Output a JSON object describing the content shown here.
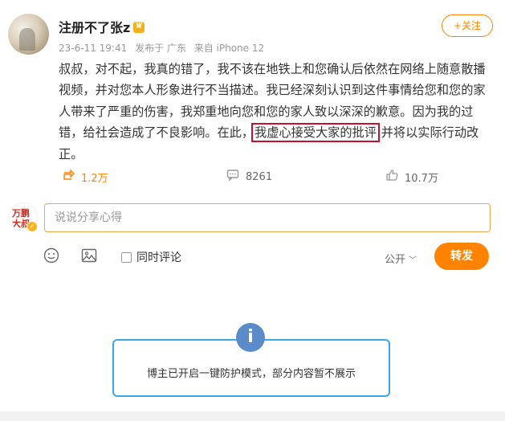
{
  "post": {
    "username": "注册不了张z",
    "date": "23-6-11 19:41",
    "source_location": "发布于 广东",
    "device": "来自 iPhone 12",
    "follow_label": "+关注",
    "text_part1": "叔叔，对不起，我真的错了，我不该在地铁上和您确认后依然在网络上随意散播视频，并对您本人形象进行不当描述。我已经深刻认识到这件事情给您和您的家人带来了严重的伤害，我郑重地向您和您的家人致以深深的歉意。因为我的过错，给社会造成了不良影响。在此，",
    "text_highlight": "我虚心接受大家的批评",
    "text_part2": "  并将以实际行动改正。"
  },
  "actions": {
    "repost_count": "1.2万",
    "comment_count": "8261",
    "like_count": "10.7万"
  },
  "composer": {
    "avatar_line1": "万鹏",
    "avatar_line2": "大叔",
    "placeholder": "说说分享心得",
    "same_time_comment": "同时评论",
    "visibility": "公开",
    "send_label": "转发"
  },
  "notice": {
    "text": "博主已开启一键防护模式，部分内容暂不展示"
  },
  "colors": {
    "accent": "#ff8200",
    "highlight_border": "#c8102e",
    "notice_border": "#3aa6e6",
    "info_icon": "#5b8cc9"
  }
}
